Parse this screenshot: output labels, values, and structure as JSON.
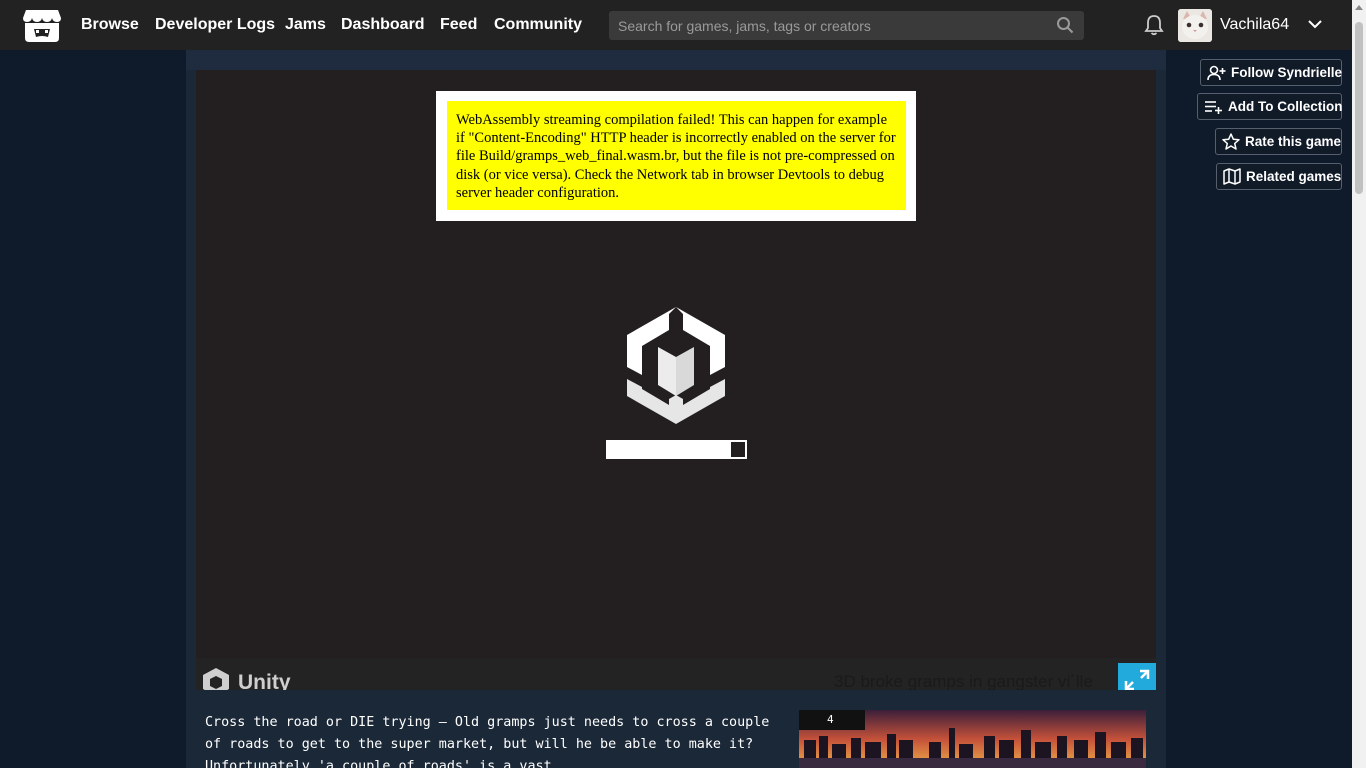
{
  "nav": {
    "links": [
      "Browse",
      "Developer Logs",
      "Jams",
      "Dashboard",
      "Feed",
      "Community"
    ],
    "search_placeholder": "Search for games, jams, tags or creators",
    "username": "Vachila64"
  },
  "sidebar_buttons": {
    "follow": "Follow Syndrielle",
    "collection": "Add To Collection",
    "rate": "Rate this game",
    "related": "Related games"
  },
  "player": {
    "error_message": "WebAssembly streaming compilation failed! This can happen for example if \"Content-Encoding\" HTTP header is incorrectly enabled on the server for file Build/gramps_web_final.wasm.br, but the file is not pre-compressed on disk (or vice versa). Check the Network tab in browser Devtools to debug server header configuration.",
    "progress": 0.9,
    "footer_brand": "Unity",
    "game_title": "3D broke gramps in gangster vi´lle"
  },
  "description": {
    "text": "Cross the road or DIE trying – Old gramps just needs to cross a couple of roads to get to the super market, but will he be able to make it? Unfortunately 'a couple of roads' is a vast",
    "thumb_badge": "4"
  },
  "colors": {
    "topbar": "#222222",
    "page_bg": "#0f1a2a",
    "error_bg": "#ffff00",
    "fullscreen": "#22aadd"
  }
}
